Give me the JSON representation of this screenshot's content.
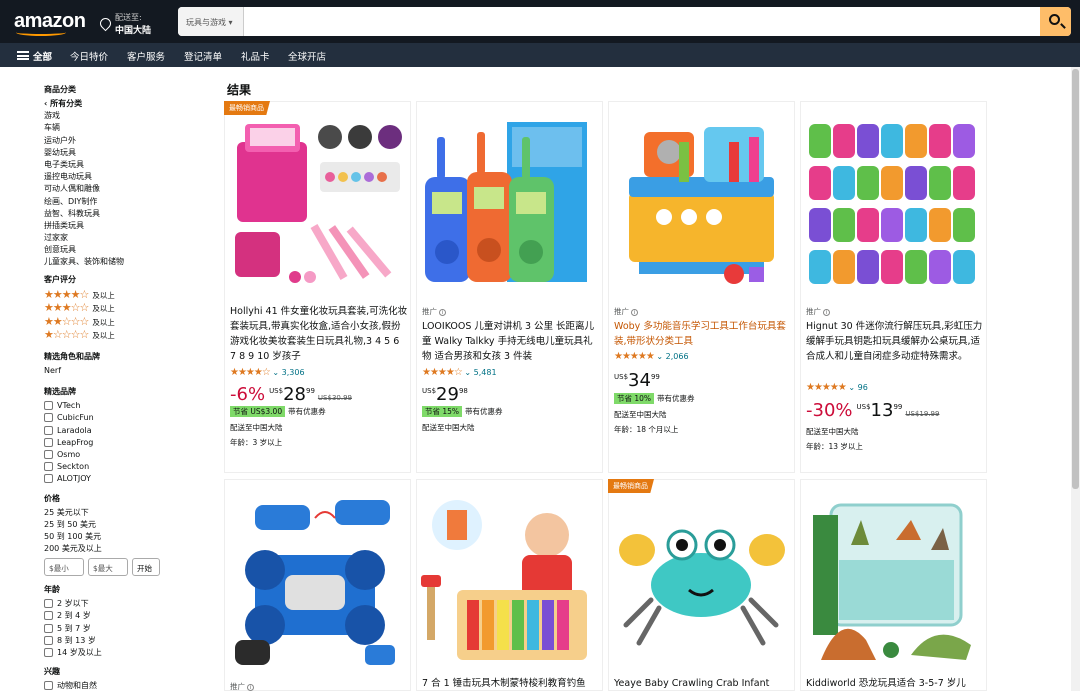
{
  "header": {
    "logo": "amazon",
    "deliver_to": "配送至:",
    "location": "中国大陆",
    "search_category": "玩具与游戏 ▾",
    "search_placeholder": ""
  },
  "subnav": {
    "all": "全部",
    "items": [
      "今日特价",
      "客户服务",
      "登记清单",
      "礼品卡",
      "全球开店"
    ]
  },
  "sidebar": {
    "category_title": "商品分类",
    "back": "‹ 所有分类",
    "categories": [
      "游戏",
      "车辆",
      "运动户外",
      "婴幼玩具",
      "电子类玩具",
      "遥控电动玩具",
      "可动人偶和雕像",
      "绘画、DIY制作",
      "益智、科教玩具",
      "拼插类玩具",
      "过家家",
      "创意玩具",
      "儿童家具、装饰和储物"
    ],
    "rating_title": "客户评分",
    "rating_rows": [
      {
        "stars": "★★★★☆",
        "label": "及以上"
      },
      {
        "stars": "★★★☆☆",
        "label": "及以上"
      },
      {
        "stars": "★★☆☆☆",
        "label": "及以上"
      },
      {
        "stars": "★☆☆☆☆",
        "label": "及以上"
      }
    ],
    "character_title": "精选角色和品牌",
    "character_items": [
      "Nerf"
    ],
    "brand_title": "精选品牌",
    "brands": [
      "VTech",
      "CubicFun",
      "Laradola",
      "LeapFrog",
      "Osmo",
      "Seckton",
      "ALOTJOY"
    ],
    "price_title": "价格",
    "prices": [
      "25 美元以下",
      "25 到 50 美元",
      "50 到 100 美元",
      "200 美元及以上"
    ],
    "min_placeholder": "$最小",
    "max_placeholder": "$最大",
    "go": "开始",
    "age_title": "年龄",
    "ages": [
      "2 岁以下",
      "2 到 4 岁",
      "5 到 7 岁",
      "8 到 13 岁",
      "14 岁及以上"
    ],
    "interest_title": "兴趣",
    "interest_first": "动物和自然"
  },
  "results_title": "结果",
  "products": [
    {
      "badge": "最畅销商品",
      "title": "Hollyhi 41 件女童化妆玩具套装,可洗化妆套装玩具,带真实化妆盒,适合小女孩,假扮游戏化妆美妆套装生日玩具礼物,3 4 5 6 7 8 9 10 岁孩子",
      "rating": "★★★★☆",
      "reviews": "3,306",
      "discount": "-6%",
      "currency": "US$",
      "whole": "28",
      "fraction": "99",
      "list_price": "US$30.99",
      "save_tag": "节省 US$3.00",
      "save_text": "带有优惠券",
      "ship": "配送至中国大陆",
      "age": "年龄：3 岁以上"
    },
    {
      "sponsored": "推广",
      "title": "LOOIKOOS 儿童对讲机 3 公里 长距离儿童 Walky Talkky 手持无线电儿童玩具礼物 适合男孩和女孩 3 件装",
      "rating": "★★★★☆",
      "reviews": "5,481",
      "currency": "US$",
      "whole": "29",
      "fraction": "98",
      "save_tag": "节省 15%",
      "save_text": "带有优惠券",
      "ship": "配送至中国大陆"
    },
    {
      "sponsored": "推广",
      "title": "Woby 多功能音乐学习工具工作台玩具套装,带形状分类工具",
      "rating": "★★★★★",
      "reviews": "2,066",
      "currency": "US$",
      "whole": "34",
      "fraction": "99",
      "save_tag": "节省 10%",
      "save_text": "带有优惠券",
      "ship": "配送至中国大陆",
      "age": "年龄：18 个月以上"
    },
    {
      "sponsored": "推广",
      "title": "Hignut 30 件迷你流行解压玩具,彩虹压力缓解手玩具钥匙扣玩具缓解办公桌玩具,适合成人和儿童自闭症多动症特殊需求。",
      "rating": "★★★★★",
      "reviews": "96",
      "discount": "-30%",
      "currency": "US$",
      "whole": "13",
      "fraction": "99",
      "list_price": "US$19.99",
      "ship": "配送至中国大陆",
      "age": "年龄：13 岁以上"
    },
    {
      "sponsored": "推广",
      "title": ""
    },
    {
      "title": "7 合 1 锤击玩具木制蒙特梭利教育钓鱼"
    },
    {
      "badge": "最畅销商品",
      "title": "Yeaye Baby Crawling Crab Infant"
    },
    {
      "title": "Kiddiworld 恐龙玩具适合 3-5-7 岁儿"
    }
  ],
  "colors": {
    "header": "#131921",
    "subnav": "#232f3e",
    "accent": "#febd69",
    "badge": "#e47911",
    "star": "#de7921"
  }
}
